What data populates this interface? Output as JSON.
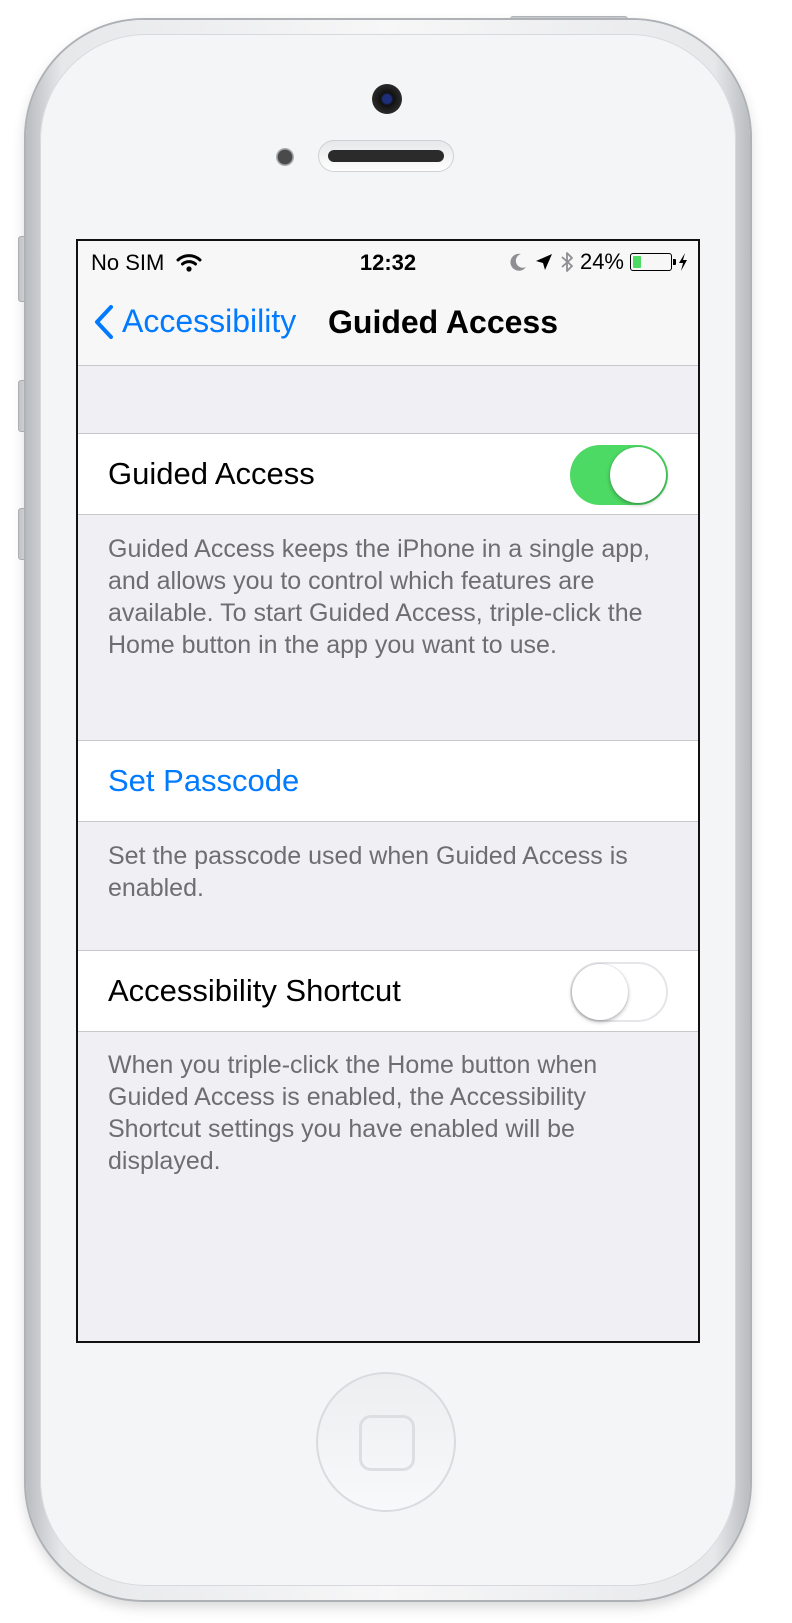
{
  "status_bar": {
    "carrier": "No SIM",
    "time": "12:32",
    "battery_text": "24%",
    "battery_level": 0.24,
    "icons": [
      "wifi-icon",
      "moon-icon",
      "location-arrow-icon",
      "bluetooth-icon",
      "battery-icon",
      "charging-bolt-icon"
    ]
  },
  "nav": {
    "back_label": "Accessibility",
    "title": "Guided Access"
  },
  "sections": {
    "guided_access": {
      "label": "Guided Access",
      "toggle_on": true,
      "footer": "Guided Access keeps the iPhone in a single app, and allows you to control which features are available. To start Guided Access, triple-click the Home button in the app you want to use."
    },
    "passcode": {
      "label": "Set Passcode",
      "footer": "Set the passcode used when Guided Access is enabled."
    },
    "shortcut": {
      "label": "Accessibility Shortcut",
      "toggle_on": false,
      "footer": "When you triple-click the Home button when Guided Access is enabled, the Accessibility Shortcut settings you have enabled will be displayed."
    }
  },
  "colors": {
    "accent": "#007aff",
    "toggle_on": "#4cd964",
    "group_background": "#efeff4",
    "footer_text": "#6d6d72"
  }
}
